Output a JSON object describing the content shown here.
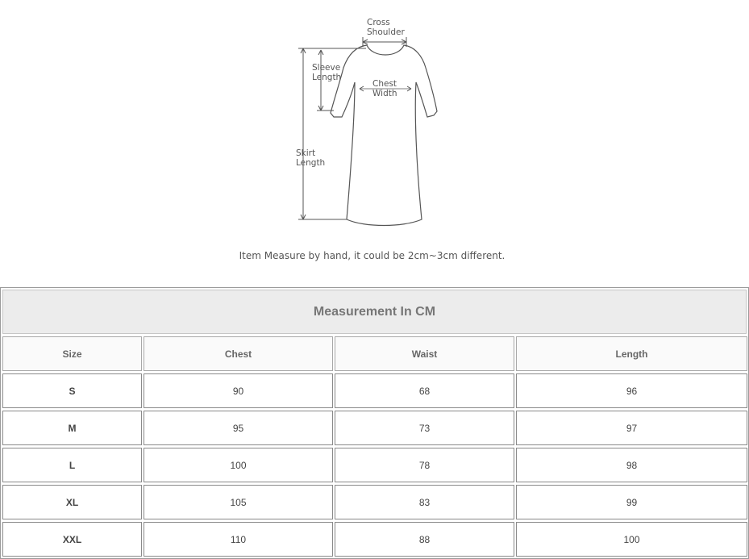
{
  "diagram": {
    "labels": {
      "cross_shoulder": [
        "Cross",
        "Shoulder"
      ],
      "sleeve_length": [
        "Sleeve",
        "Length"
      ],
      "chest_width": [
        "Chest",
        "Width"
      ],
      "skirt_length": [
        "Skirt",
        "Length"
      ]
    },
    "note": "Item Measure by hand, it could be 2cm~3cm different."
  },
  "table": {
    "title": "Measurement In CM",
    "headers": [
      "Size",
      "Chest",
      "Waist",
      "Length"
    ],
    "rows": [
      [
        "S",
        "90",
        "68",
        "96"
      ],
      [
        "M",
        "95",
        "73",
        "97"
      ],
      [
        "L",
        "100",
        "78",
        "98"
      ],
      [
        "XL",
        "105",
        "83",
        "99"
      ],
      [
        "XXL",
        "110",
        "88",
        "100"
      ]
    ]
  },
  "colors": {
    "line": "#555555",
    "title_bg": "#ececec",
    "border": "#8a8a8a"
  }
}
